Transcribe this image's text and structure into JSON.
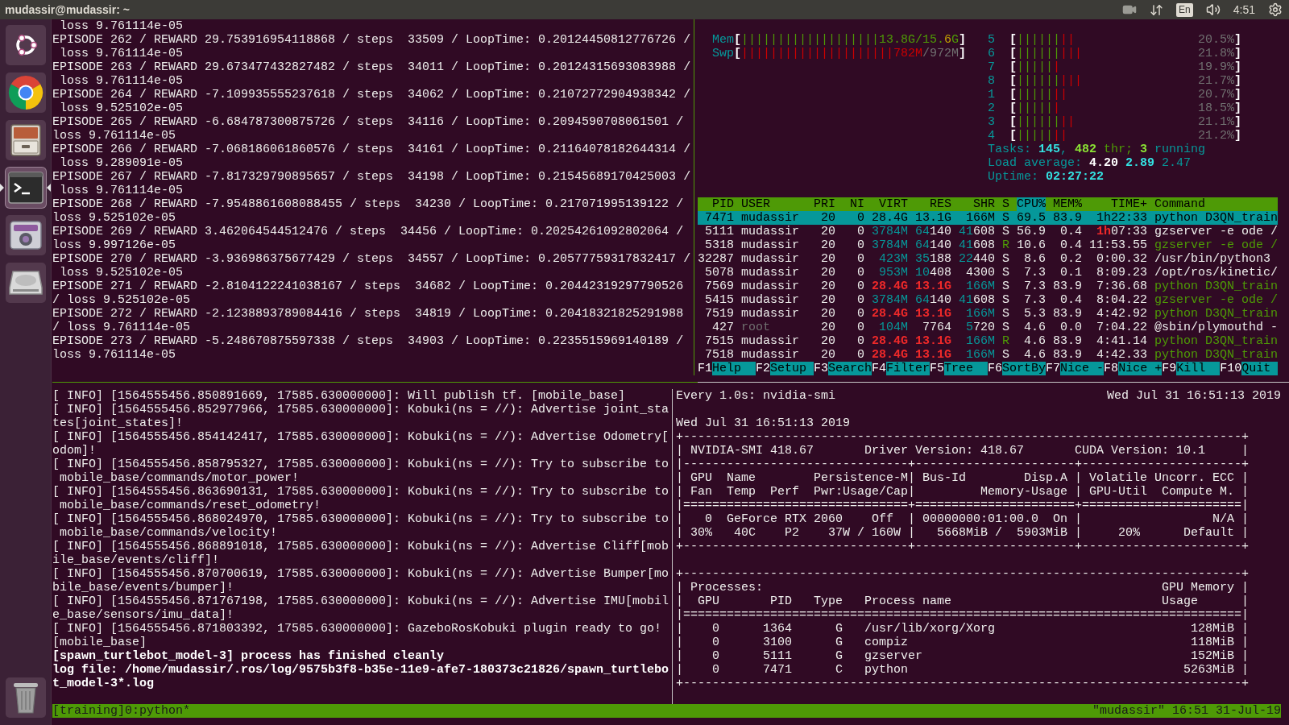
{
  "top_bar": {
    "title": "mudassir@mudassir: ~",
    "indicators": [
      {
        "kind": "camera"
      },
      {
        "kind": "network"
      },
      {
        "kind": "keyboard",
        "text": "En"
      },
      {
        "kind": "volume"
      },
      {
        "kind": "clock",
        "text": "4:51"
      },
      {
        "kind": "settings"
      }
    ]
  },
  "launcher": [
    {
      "kind": "dash",
      "focused": false
    },
    {
      "kind": "browser",
      "focused": false
    },
    {
      "kind": "files",
      "focused": false
    },
    {
      "kind": "terminal",
      "focused": true
    },
    {
      "kind": "webcam",
      "focused": false
    },
    {
      "kind": "disk",
      "focused": false
    },
    {
      "kind": "trash",
      "focused": false
    }
  ],
  "training_log": [
    " loss 9.761114e-05",
    "EPISODE 262 / REWARD 29.753916954118868 / steps  33509 / LoopTime: 0.20124450812776726 /",
    " loss 9.761114e-05",
    "EPISODE 263 / REWARD 29.673477432827482 / steps  34011 / LoopTime: 0.20124315693083988 /",
    " loss 9.761114e-05",
    "EPISODE 264 / REWARD -7.109935555237618 / steps  34062 / LoopTime: 0.21072772904938342 /",
    " loss 9.525102e-05",
    "EPISODE 265 / REWARD -6.684787300875726 / steps  34116 / LoopTime: 0.2094590708061501 /",
    "loss 9.761114e-05",
    "EPISODE 266 / REWARD -7.068186061860576 / steps  34161 / LoopTime: 0.21164078182644314 /",
    " loss 9.289091e-05",
    "EPISODE 267 / REWARD -7.817329790895657 / steps  34198 / LoopTime: 0.21545689170425003 /",
    " loss 9.761114e-05",
    "EPISODE 268 / REWARD -7.9548861608088455 / steps  34230 / LoopTime: 0.217071995139122 /",
    "loss 9.525102e-05",
    "EPISODE 269 / REWARD 3.462064544512476 / steps  34456 / LoopTime: 0.20254261092802064 /",
    "loss 9.997126e-05",
    "EPISODE 270 / REWARD -3.936986375677429 / steps  34557 / LoopTime: 0.20577759317832417 /",
    " loss 9.525102e-05",
    "EPISODE 271 / REWARD -2.8104122241038167 / steps  34682 / LoopTime: 0.20442319297790526",
    "/ loss 9.525102e-05",
    "EPISODE 272 / REWARD -2.1238893789084416 / steps  34819 / LoopTime: 0.20418321825291988",
    "/ loss 9.761114e-05",
    "EPISODE 273 / REWARD -5.248670875597338 / steps  34903 / LoopTime: 0.2235515969140189 /",
    "loss 9.761114e-05"
  ],
  "htop": {
    "memory_meters": [
      {
        "label": "Mem",
        "open": "[",
        "bar": [
          {
            "text": "|||||||||||||||||||",
            "kind": "low"
          }
        ],
        "reading": [
          {
            "text": "13.8G/15.",
            "kind": "low"
          },
          {
            "text": "6",
            "kind": "warn"
          },
          {
            "text": "G",
            "kind": "low"
          }
        ],
        "close": "]"
      },
      {
        "label": "Swp",
        "open": "[",
        "bar": [
          {
            "text": "|||||||||||||||||||||",
            "kind": "high"
          }
        ],
        "reading": [
          {
            "text": "782M",
            "kind": "high"
          },
          {
            "text": "/972M",
            "kind": "dim"
          }
        ],
        "close": "]"
      }
    ],
    "cpu_meters": [
      {
        "label": "5",
        "open": "[",
        "bar": [
          {
            "text": "||||||",
            "kind": "low"
          },
          {
            "text": "||",
            "kind": "high"
          }
        ],
        "reading": [
          {
            "text": "20.5%",
            "kind": "dim"
          }
        ],
        "close": "]"
      },
      {
        "label": "6",
        "open": "[",
        "bar": [
          {
            "text": "||||||",
            "kind": "low"
          },
          {
            "text": "|||",
            "kind": "high"
          }
        ],
        "reading": [
          {
            "text": "21.8%",
            "kind": "dim"
          }
        ],
        "close": "]"
      },
      {
        "label": "7",
        "open": "[",
        "bar": [
          {
            "text": "|||||",
            "kind": "low"
          },
          {
            "text": "|",
            "kind": "high"
          }
        ],
        "reading": [
          {
            "text": "19.9%",
            "kind": "dim"
          }
        ],
        "close": "]"
      },
      {
        "label": "8",
        "open": "[",
        "bar": [
          {
            "text": "||||||",
            "kind": "low"
          },
          {
            "text": "|||",
            "kind": "high"
          }
        ],
        "reading": [
          {
            "text": "21.7%",
            "kind": "dim"
          }
        ],
        "close": "]"
      },
      {
        "label": "1",
        "open": "[",
        "bar": [
          {
            "text": "|||||",
            "kind": "low"
          },
          {
            "text": "||",
            "kind": "high"
          }
        ],
        "reading": [
          {
            "text": "20.7%",
            "kind": "dim"
          }
        ],
        "close": "]"
      },
      {
        "label": "2",
        "open": "[",
        "bar": [
          {
            "text": "|||||",
            "kind": "low"
          },
          {
            "text": "|",
            "kind": "high"
          }
        ],
        "reading": [
          {
            "text": "18.5%",
            "kind": "dim"
          }
        ],
        "close": "]"
      },
      {
        "label": "3",
        "open": "[",
        "bar": [
          {
            "text": "||||||",
            "kind": "low"
          },
          {
            "text": "||",
            "kind": "high"
          }
        ],
        "reading": [
          {
            "text": "21.1%",
            "kind": "dim"
          }
        ],
        "close": "]"
      },
      {
        "label": "4",
        "open": "[",
        "bar": [
          {
            "text": "|||||",
            "kind": "low"
          },
          {
            "text": "||",
            "kind": "high"
          }
        ],
        "reading": [
          {
            "text": "21.2%",
            "kind": "dim"
          }
        ],
        "close": "]"
      }
    ],
    "summary": [
      [
        {
          "text": "Tasks: ",
          "kind": "cyan"
        },
        {
          "text": "145",
          "kind": "bright_cyan"
        },
        {
          "text": ", ",
          "kind": "cyan"
        },
        {
          "text": "482",
          "kind": "bright_green"
        },
        {
          "text": " thr; ",
          "kind": "low"
        },
        {
          "text": "3",
          "kind": "bright_green"
        },
        {
          "text": " running",
          "kind": "cyan"
        }
      ],
      [
        {
          "text": "Load average: ",
          "kind": "cyan"
        },
        {
          "text": "4.20 ",
          "kind": "bold"
        },
        {
          "text": "2.89 ",
          "kind": "bright_cyan"
        },
        {
          "text": "2.47",
          "kind": "cyan"
        }
      ],
      [
        {
          "text": "Uptime: ",
          "kind": "cyan"
        },
        {
          "text": "02:27:22",
          "kind": "bright_cyan"
        }
      ]
    ],
    "columns": [
      {
        "label": "PID",
        "sorted": false
      },
      {
        "label": "USER",
        "sorted": false
      },
      {
        "label": "PRI",
        "sorted": false
      },
      {
        "label": "NI",
        "sorted": false
      },
      {
        "label": "VIRT",
        "sorted": false
      },
      {
        "label": "RES",
        "sorted": false
      },
      {
        "label": "SHR",
        "sorted": false
      },
      {
        "label": "S",
        "sorted": false
      },
      {
        "label": "CPU%",
        "sorted": true
      },
      {
        "label": "MEM%",
        "sorted": false
      },
      {
        "label": "TIME+",
        "sorted": false
      },
      {
        "label": "Command",
        "sorted": false
      }
    ],
    "rows": [
      {
        "selected": true,
        "cells": [
          "7471",
          "mudassir",
          "20",
          "0",
          "28.4G",
          "13.1G",
          "166M",
          "S",
          "69.5",
          "83.9",
          "1h22:33",
          "python D3QN_train"
        ]
      },
      {
        "selected": false,
        "cells": [
          "5111",
          "mudassir",
          "20",
          "0",
          [
            {
              "text": "3784M",
              "kind": "cyan"
            }
          ],
          [
            {
              "text": "64",
              "kind": "cyan"
            },
            {
              "text": "140",
              "kind": "plain"
            }
          ],
          [
            {
              "text": "41",
              "kind": "cyan"
            },
            {
              "text": "608",
              "kind": "plain"
            }
          ],
          "S",
          "56.9",
          "0.4",
          [
            {
              "text": "1h",
              "kind": "hot"
            },
            {
              "text": "07:33",
              "kind": "plain"
            }
          ],
          "gzserver -e ode /"
        ]
      },
      {
        "selected": false,
        "cells": [
          "5318",
          "mudassir",
          "20",
          "0",
          [
            {
              "text": "3784M",
              "kind": "cyan"
            }
          ],
          [
            {
              "text": "64",
              "kind": "cyan"
            },
            {
              "text": "140",
              "kind": "plain"
            }
          ],
          [
            {
              "text": "41",
              "kind": "cyan"
            },
            {
              "text": "608",
              "kind": "plain"
            }
          ],
          [
            {
              "text": "R",
              "kind": "thread"
            }
          ],
          "10.6",
          "0.4",
          "11:53.55",
          [
            {
              "text": "gzserver -e ode /",
              "kind": "thread"
            }
          ]
        ]
      },
      {
        "selected": false,
        "cells": [
          "32287",
          "mudassir",
          "20",
          "0",
          [
            {
              "text": "423M",
              "kind": "cyan"
            }
          ],
          [
            {
              "text": "35",
              "kind": "cyan"
            },
            {
              "text": "188",
              "kind": "plain"
            }
          ],
          [
            {
              "text": "22",
              "kind": "cyan"
            },
            {
              "text": "440",
              "kind": "plain"
            }
          ],
          "S",
          "8.6",
          "0.2",
          "0:00.32",
          "/usr/bin/python3"
        ]
      },
      {
        "selected": false,
        "cells": [
          "5078",
          "mudassir",
          "20",
          "0",
          [
            {
              "text": "953M",
              "kind": "cyan"
            }
          ],
          [
            {
              "text": "10",
              "kind": "cyan"
            },
            {
              "text": "408",
              "kind": "plain"
            }
          ],
          "4300",
          "S",
          "7.3",
          "0.1",
          "8:09.23",
          "/opt/ros/kinetic/"
        ]
      },
      {
        "selected": false,
        "cells": [
          "7569",
          "mudassir",
          "20",
          "0",
          [
            {
              "text": "28.4G",
              "kind": "hot"
            }
          ],
          [
            {
              "text": "13.1G",
              "kind": "hot"
            }
          ],
          [
            {
              "text": "166M",
              "kind": "cyan"
            }
          ],
          "S",
          "7.3",
          "83.9",
          "7:36.68",
          [
            {
              "text": "python D3QN_train",
              "kind": "thread"
            }
          ]
        ]
      },
      {
        "selected": false,
        "cells": [
          "5415",
          "mudassir",
          "20",
          "0",
          [
            {
              "text": "3784M",
              "kind": "cyan"
            }
          ],
          [
            {
              "text": "64",
              "kind": "cyan"
            },
            {
              "text": "140",
              "kind": "plain"
            }
          ],
          [
            {
              "text": "41",
              "kind": "cyan"
            },
            {
              "text": "608",
              "kind": "plain"
            }
          ],
          "S",
          "7.3",
          "0.4",
          "8:04.22",
          [
            {
              "text": "gzserver -e ode /",
              "kind": "thread"
            }
          ]
        ]
      },
      {
        "selected": false,
        "cells": [
          "7519",
          "mudassir",
          "20",
          "0",
          [
            {
              "text": "28.4G",
              "kind": "hot"
            }
          ],
          [
            {
              "text": "13.1G",
              "kind": "hot"
            }
          ],
          [
            {
              "text": "166M",
              "kind": "cyan"
            }
          ],
          "S",
          "5.3",
          "83.9",
          "4:42.92",
          [
            {
              "text": "python D3QN_train",
              "kind": "thread"
            }
          ]
        ]
      },
      {
        "selected": false,
        "cells": [
          "427",
          [
            {
              "text": "root",
              "kind": "dim"
            }
          ],
          "20",
          "0",
          [
            {
              "text": "104M",
              "kind": "cyan"
            }
          ],
          "7764",
          [
            {
              "text": "5",
              "kind": "cyan"
            },
            {
              "text": "720",
              "kind": "plain"
            }
          ],
          "S",
          "4.6",
          "0.0",
          "7:04.22",
          "@sbin/plymouthd -"
        ]
      },
      {
        "selected": false,
        "cells": [
          "7515",
          "mudassir",
          "20",
          "0",
          [
            {
              "text": "28.4G",
              "kind": "hot"
            }
          ],
          [
            {
              "text": "13.1G",
              "kind": "hot"
            }
          ],
          [
            {
              "text": "166M",
              "kind": "cyan"
            }
          ],
          [
            {
              "text": "R",
              "kind": "thread"
            }
          ],
          "4.6",
          "83.9",
          "4:41.14",
          [
            {
              "text": "python D3QN_train",
              "kind": "thread"
            }
          ]
        ]
      },
      {
        "selected": false,
        "cells": [
          "7518",
          "mudassir",
          "20",
          "0",
          [
            {
              "text": "28.4G",
              "kind": "hot"
            }
          ],
          [
            {
              "text": "13.1G",
              "kind": "hot"
            }
          ],
          [
            {
              "text": "166M",
              "kind": "cyan"
            }
          ],
          "S",
          "4.6",
          "83.9",
          "4:42.33",
          [
            {
              "text": "python D3QN_train",
              "kind": "thread"
            }
          ]
        ]
      }
    ],
    "function_keys": [
      {
        "key": "F1",
        "label": "Help"
      },
      {
        "key": "F2",
        "label": "Setup"
      },
      {
        "key": "F3",
        "label": "Search"
      },
      {
        "key": "F4",
        "label": "Filter"
      },
      {
        "key": "F5",
        "label": "Tree"
      },
      {
        "key": "F6",
        "label": "SortBy"
      },
      {
        "key": "F7",
        "label": "Nice -"
      },
      {
        "key": "F8",
        "label": "Nice +"
      },
      {
        "key": "F9",
        "label": "Kill"
      },
      {
        "key": "F10",
        "label": "Quit"
      }
    ]
  },
  "ros_log": [
    {
      "text": "[ INFO] [1564555456.850891669, 17585.630000000]: Will publish tf. [mobile_base]",
      "bold": false
    },
    {
      "text": "[ INFO] [1564555456.852977966, 17585.630000000]: Kobuki(ns = //): Advertise joint_sta",
      "bold": false
    },
    {
      "text": "tes[joint_states]!",
      "bold": false
    },
    {
      "text": "[ INFO] [1564555456.854142417, 17585.630000000]: Kobuki(ns = //): Advertise Odometry[",
      "bold": false
    },
    {
      "text": "odom]!",
      "bold": false
    },
    {
      "text": "[ INFO] [1564555456.858795327, 17585.630000000]: Kobuki(ns = //): Try to subscribe to",
      "bold": false
    },
    {
      "text": " mobile_base/commands/motor_power!",
      "bold": false
    },
    {
      "text": "[ INFO] [1564555456.863690131, 17585.630000000]: Kobuki(ns = //): Try to subscribe to",
      "bold": false
    },
    {
      "text": " mobile_base/commands/reset_odometry!",
      "bold": false
    },
    {
      "text": "[ INFO] [1564555456.868024970, 17585.630000000]: Kobuki(ns = //): Try to subscribe to",
      "bold": false
    },
    {
      "text": " mobile_base/commands/velocity!",
      "bold": false
    },
    {
      "text": "[ INFO] [1564555456.868891018, 17585.630000000]: Kobuki(ns = //): Advertise Cliff[mob",
      "bold": false
    },
    {
      "text": "ile_base/events/cliff]!",
      "bold": false
    },
    {
      "text": "[ INFO] [1564555456.870700619, 17585.630000000]: Kobuki(ns = //): Advertise Bumper[mo",
      "bold": false
    },
    {
      "text": "bile_base/events/bumper]!",
      "bold": false
    },
    {
      "text": "[ INFO] [1564555456.871767198, 17585.630000000]: Kobuki(ns = //): Advertise IMU[mobil",
      "bold": false
    },
    {
      "text": "e_base/sensors/imu_data]!",
      "bold": false
    },
    {
      "text": "[ INFO] [1564555456.871803392, 17585.630000000]: GazeboRosKobuki plugin ready to go!",
      "bold": false
    },
    {
      "text": "[mobile_base]",
      "bold": false
    },
    {
      "text": "[spawn_turtlebot_model-3] process has finished cleanly",
      "bold": true
    },
    {
      "text": "log file: /home/mudassir/.ros/log/9575b3f8-b35e-11e9-afe7-180373c21826/spawn_turtlebo",
      "bold": true
    },
    {
      "text": "t_model-3*.log",
      "bold": true
    }
  ],
  "nvidia_smi": {
    "command": "Every 1.0s: nvidia-smi",
    "clock": "Wed Jul 31 16:51:13 2019",
    "timestamp": "Wed Jul 31 16:51:13 2019",
    "gpu_table": [
      "+-----------------------------------------------------------------------------+",
      "| NVIDIA-SMI 418.67       Driver Version: 418.67       CUDA Version: 10.1     |",
      "|-------------------------------+----------------------+----------------------+",
      "| GPU  Name        Persistence-M| Bus-Id        Disp.A | Volatile Uncorr. ECC |",
      "| Fan  Temp  Perf  Pwr:Usage/Cap|         Memory-Usage | GPU-Util  Compute M. |",
      "|===============================+======================+======================|",
      "|   0  GeForce RTX 2060    Off  | 00000000:01:00.0  On |                  N/A |",
      "| 30%   40C    P2    37W / 160W |   5668MiB /  5903MiB |     20%      Default |",
      "+-------------------------------+----------------------+----------------------+"
    ],
    "process_table": [
      "+-----------------------------------------------------------------------------+",
      "| Processes:                                                       GPU Memory |",
      "|  GPU       PID   Type   Process name                             Usage      |",
      "|=============================================================================|",
      "|    0      1364      G   /usr/lib/xorg/Xorg                           128MiB |",
      "|    0      3100      G   compiz                                       118MiB |",
      "|    0      5111      G   gzserver                                     152MiB |",
      "|    0      7471      C   python                                      5263MiB |",
      "+-----------------------------------------------------------------------------+"
    ]
  },
  "status_bar": {
    "window": "[training]0:python*",
    "host_clock": "\"mudassir\" 16:51 31-Jul-19"
  }
}
